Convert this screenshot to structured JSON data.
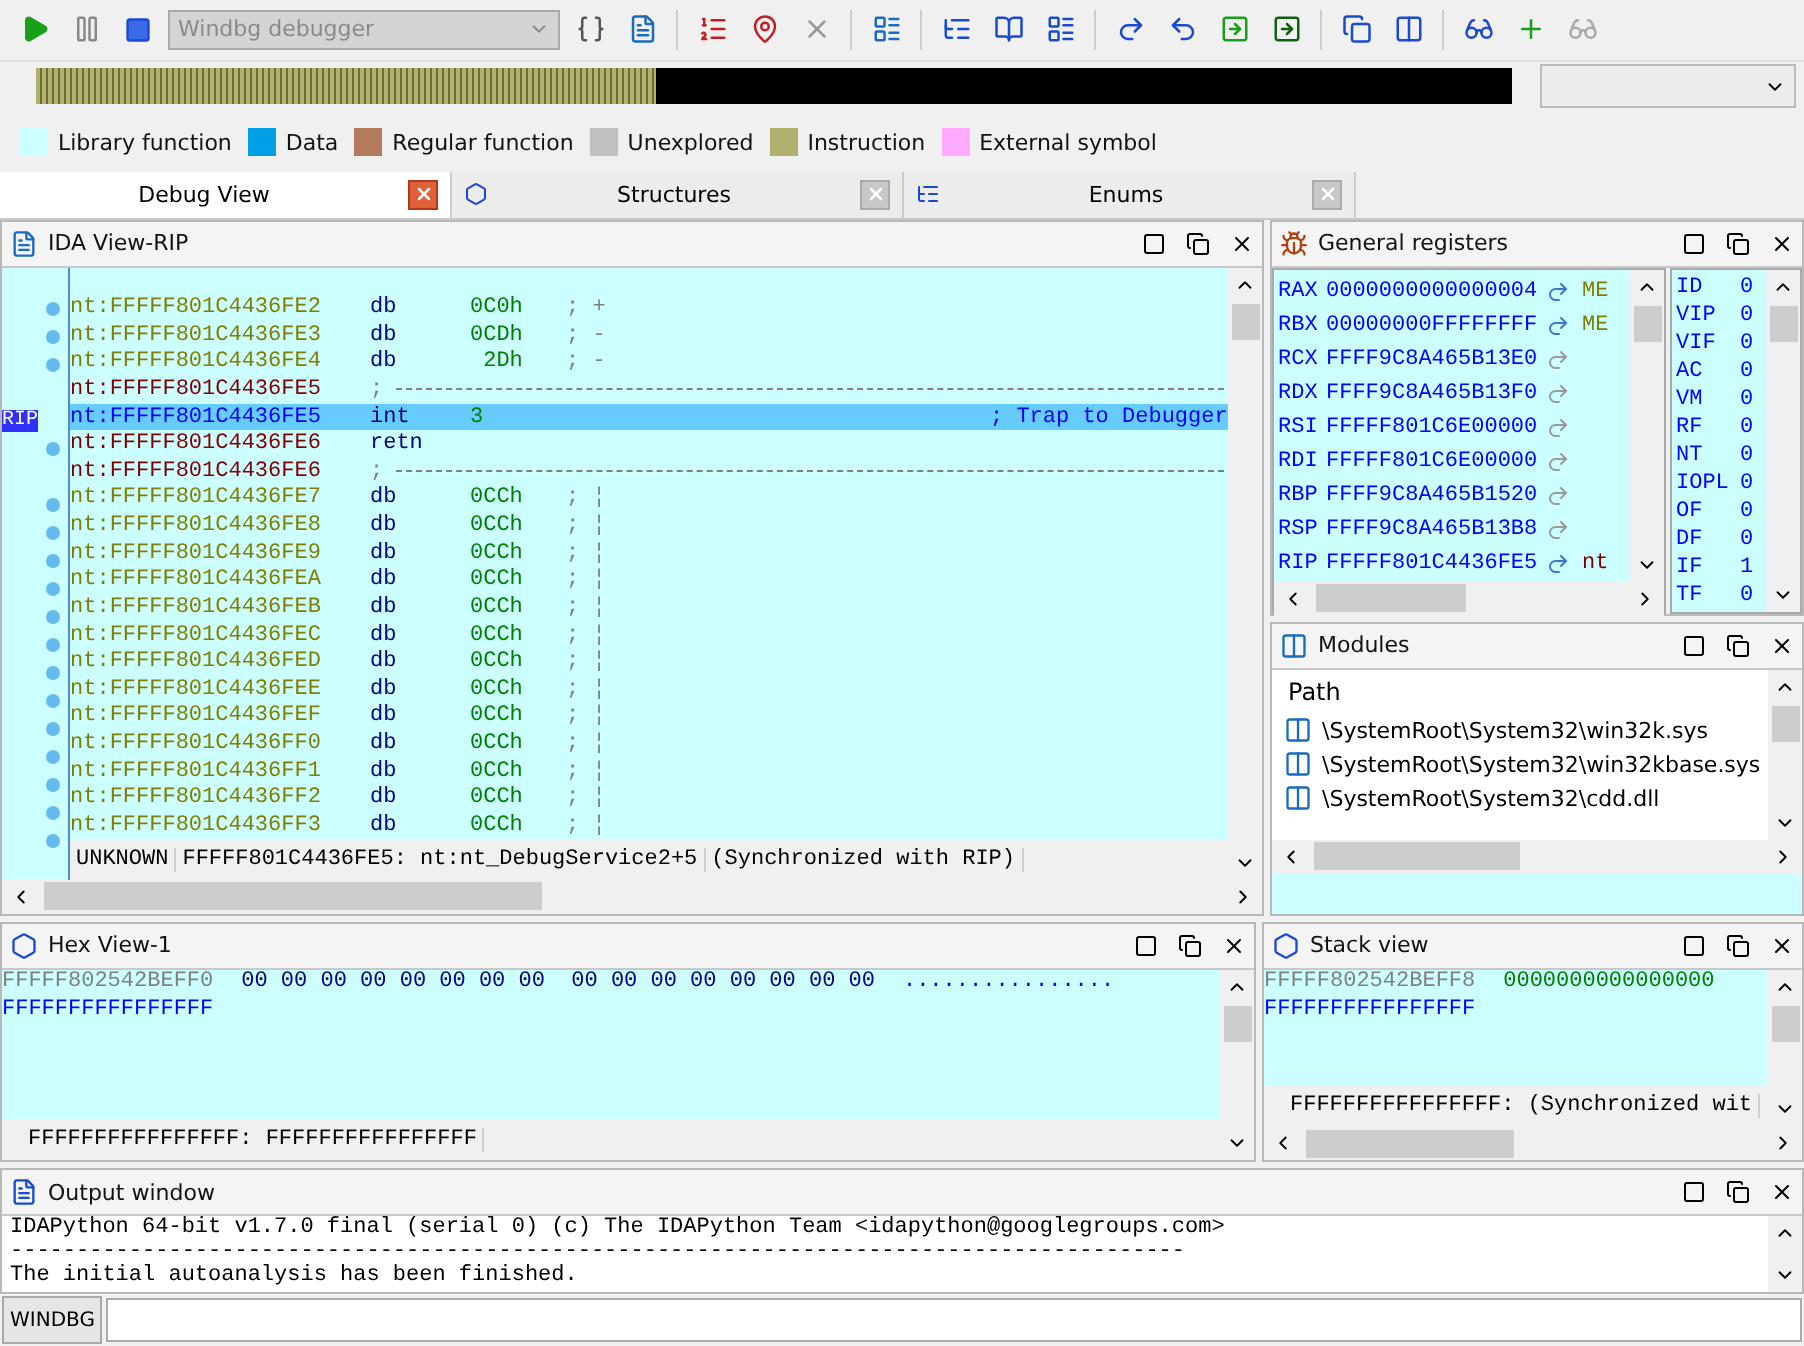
{
  "toolbar": {
    "debugger_select": {
      "value": "Windbg debugger",
      "disabled": true
    }
  },
  "navigation_bar": {
    "level": 0.42
  },
  "legend": [
    {
      "label": "Library function",
      "color": "#ccffff"
    },
    {
      "label": "Data",
      "color": "#00a0e8"
    },
    {
      "label": "Regular function",
      "color": "#b47a5c"
    },
    {
      "label": "Unexplored",
      "color": "#c0c0c0"
    },
    {
      "label": "Instruction",
      "color": "#b0b070"
    },
    {
      "label": "External symbol",
      "color": "#ffaaff"
    }
  ],
  "tabs": [
    {
      "label": "Debug View",
      "selected": true,
      "closable_active": true
    },
    {
      "label": "Structures",
      "selected": false,
      "closable_active": false
    },
    {
      "label": "Enums",
      "selected": false,
      "closable_active": false
    }
  ],
  "ida_view": {
    "title": "IDA View-RIP",
    "lines": [
      {
        "kind": "data",
        "segment": "nt:",
        "address": "FFFFF801C4436FE2",
        "mnemonic": "db",
        "operand": "0C0h",
        "comment": "; +"
      },
      {
        "kind": "data",
        "segment": "nt:",
        "address": "FFFFF801C4436FE3",
        "mnemonic": "db",
        "operand": "0CDh",
        "comment": "; -"
      },
      {
        "kind": "data",
        "segment": "nt:",
        "address": "FFFFF801C4436FE4",
        "mnemonic": "db",
        "operand": " 2Dh",
        "comment": "; -"
      },
      {
        "kind": "separator",
        "segment": "nt:",
        "address": "FFFFF801C4436FE5",
        "comment": ";"
      },
      {
        "kind": "current",
        "segment": "nt:",
        "address": "FFFFF801C4436FE5",
        "mnemonic": "int",
        "operand": "3",
        "comment": "; Trap to Debugger",
        "marker": "RIP"
      },
      {
        "kind": "code",
        "segment": "nt:",
        "address": "FFFFF801C4436FE6",
        "mnemonic": "retn"
      },
      {
        "kind": "separator",
        "segment": "nt:",
        "address": "FFFFF801C4436FE6",
        "comment": ";"
      },
      {
        "kind": "data",
        "segment": "nt:",
        "address": "FFFFF801C4436FE7",
        "mnemonic": "db",
        "operand": "0CCh",
        "comment": "; ¦"
      },
      {
        "kind": "data",
        "segment": "nt:",
        "address": "FFFFF801C4436FE8",
        "mnemonic": "db",
        "operand": "0CCh",
        "comment": "; ¦"
      },
      {
        "kind": "data",
        "segment": "nt:",
        "address": "FFFFF801C4436FE9",
        "mnemonic": "db",
        "operand": "0CCh",
        "comment": "; ¦"
      },
      {
        "kind": "data",
        "segment": "nt:",
        "address": "FFFFF801C4436FEA",
        "mnemonic": "db",
        "operand": "0CCh",
        "comment": "; ¦"
      },
      {
        "kind": "data",
        "segment": "nt:",
        "address": "FFFFF801C4436FEB",
        "mnemonic": "db",
        "operand": "0CCh",
        "comment": "; ¦"
      },
      {
        "kind": "data",
        "segment": "nt:",
        "address": "FFFFF801C4436FEC",
        "mnemonic": "db",
        "operand": "0CCh",
        "comment": "; ¦"
      },
      {
        "kind": "data",
        "segment": "nt:",
        "address": "FFFFF801C4436FED",
        "mnemonic": "db",
        "operand": "0CCh",
        "comment": "; ¦"
      },
      {
        "kind": "data",
        "segment": "nt:",
        "address": "FFFFF801C4436FEE",
        "mnemonic": "db",
        "operand": "0CCh",
        "comment": "; ¦"
      },
      {
        "kind": "data",
        "segment": "nt:",
        "address": "FFFFF801C4436FEF",
        "mnemonic": "db",
        "operand": "0CCh",
        "comment": "; ¦"
      },
      {
        "kind": "data",
        "segment": "nt:",
        "address": "FFFFF801C4436FF0",
        "mnemonic": "db",
        "operand": "0CCh",
        "comment": "; ¦"
      },
      {
        "kind": "data",
        "segment": "nt:",
        "address": "FFFFF801C4436FF1",
        "mnemonic": "db",
        "operand": "0CCh",
        "comment": "; ¦"
      },
      {
        "kind": "data",
        "segment": "nt:",
        "address": "FFFFF801C4436FF2",
        "mnemonic": "db",
        "operand": "0CCh",
        "comment": "; ¦"
      },
      {
        "kind": "data",
        "segment": "nt:",
        "address": "FFFFF801C4436FF3",
        "mnemonic": "db",
        "operand": "0CCh",
        "comment": "; ¦"
      }
    ],
    "status": [
      "UNKNOWN",
      "FFFFF801C4436FE5: nt:nt_DebugService2+5",
      "(Synchronized with RIP)"
    ]
  },
  "registers": {
    "title": "General registers",
    "rows": [
      {
        "name": "RAX",
        "value": "0000000000000004",
        "points_to": true,
        "target": "ME",
        "color": "#808000"
      },
      {
        "name": "RBX",
        "value": "00000000FFFFFFFF",
        "points_to": true,
        "target": "ME",
        "color": "#808000"
      },
      {
        "name": "RCX",
        "value": "FFFF9C8A465B13E0",
        "points_to": false
      },
      {
        "name": "RDX",
        "value": "FFFF9C8A465B13F0",
        "points_to": false
      },
      {
        "name": "RSI",
        "value": "FFFFF801C6E00000",
        "points_to": false
      },
      {
        "name": "RDI",
        "value": "FFFFF801C6E00000",
        "points_to": false
      },
      {
        "name": "RBP",
        "value": "FFFF9C8A465B1520",
        "points_to": false
      },
      {
        "name": "RSP",
        "value": "FFFF9C8A465B13B8",
        "points_to": false
      },
      {
        "name": "RIP",
        "value": "FFFFF801C4436FE5",
        "points_to": true,
        "target": "nt",
        "color": "#800000"
      }
    ],
    "flags": [
      {
        "name": "ID",
        "value": "0"
      },
      {
        "name": "VIP",
        "value": "0"
      },
      {
        "name": "VIF",
        "value": "0"
      },
      {
        "name": "AC",
        "value": "0"
      },
      {
        "name": "VM",
        "value": "0"
      },
      {
        "name": "RF",
        "value": "0"
      },
      {
        "name": "NT",
        "value": "0"
      },
      {
        "name": "IOPL",
        "value": "0"
      },
      {
        "name": "OF",
        "value": "0"
      },
      {
        "name": "DF",
        "value": "0"
      },
      {
        "name": "IF",
        "value": "1"
      },
      {
        "name": "TF",
        "value": "0"
      }
    ]
  },
  "modules": {
    "title": "Modules",
    "column": "Path",
    "rows": [
      "\\SystemRoot\\System32\\win32k.sys",
      "\\SystemRoot\\System32\\win32kbase.sys",
      "\\SystemRoot\\System32\\cdd.dll"
    ]
  },
  "hex_view": {
    "title": "Hex View-1",
    "lines": [
      {
        "kind": "mapped",
        "address": "FFFFF802542BEFF0",
        "bytes": "00 00 00 00 00 00 00 00  00 00 00 00 00 00 00 00",
        "ascii": "................"
      },
      {
        "kind": "invalid",
        "address": "FFFFFFFFFFFFFFFF"
      }
    ],
    "status": "FFFFFFFFFFFFFFFF: FFFFFFFFFFFFFFFF"
  },
  "stack_view": {
    "title": "Stack view",
    "lines": [
      {
        "kind": "mapped",
        "address": "FFFFF802542BEFF8",
        "value": "0000000000000000"
      },
      {
        "kind": "invalid",
        "address": "FFFFFFFFFFFFFFFF"
      }
    ],
    "status": "FFFFFFFFFFFFFFFF: (Synchronized wit"
  },
  "output": {
    "title": "Output window",
    "lines": [
      "IDAPython 64-bit v1.7.0 final (serial 0) (c) The IDAPython Team <idapython@googlegroups.com>",
      "-----------------------------------------------------------------------------------------",
      "The initial autoanalysis has been finished."
    ]
  },
  "command": {
    "label": "WINDBG"
  }
}
